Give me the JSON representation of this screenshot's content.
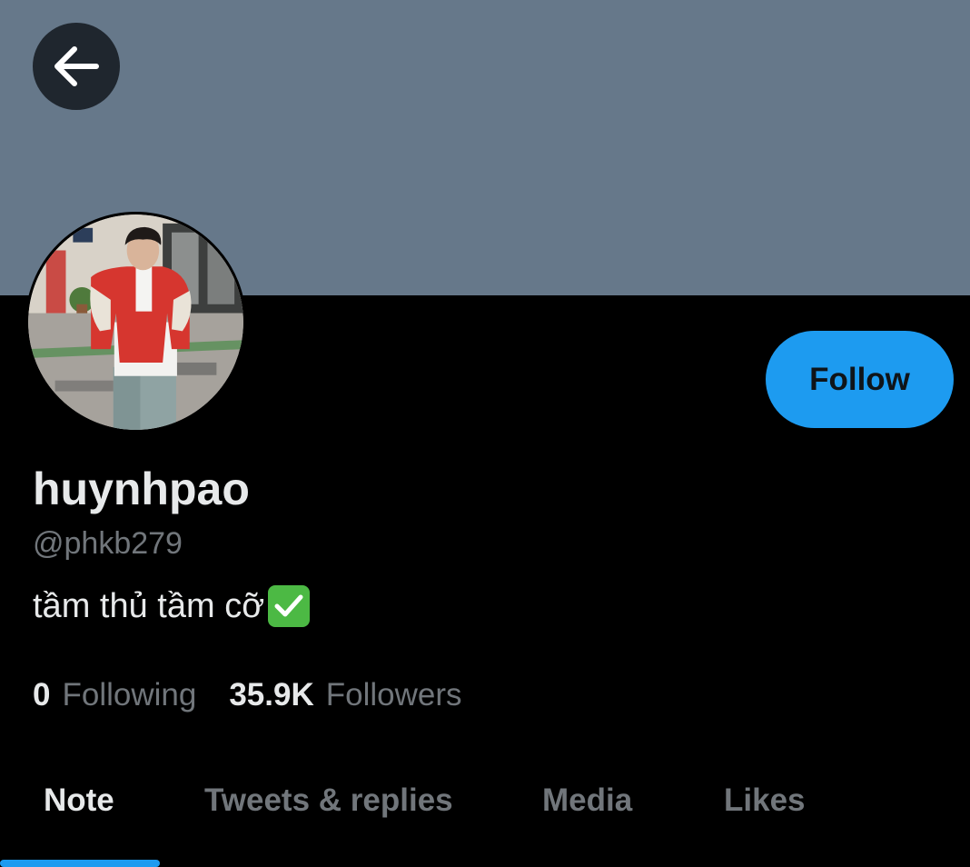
{
  "header": {
    "banner_color": "#66788a",
    "back_icon": "arrow-left-icon"
  },
  "profile": {
    "display_name": "huynhpao",
    "handle": "@phkb279",
    "bio_text": "tầm thủ tầm cỡ",
    "bio_emoji_icon": "check-mark-button-icon",
    "avatar_icon": "profile-photo"
  },
  "actions": {
    "follow_label": "Follow",
    "accent_color": "#1d9bf0"
  },
  "stats": {
    "following_count": "0",
    "following_label": "Following",
    "followers_count": "35.9K",
    "followers_label": "Followers"
  },
  "tabs": [
    {
      "label": "Note",
      "active": true
    },
    {
      "label": "Tweets & replies",
      "active": false
    },
    {
      "label": "Media",
      "active": false
    },
    {
      "label": "Likes",
      "active": false
    }
  ]
}
